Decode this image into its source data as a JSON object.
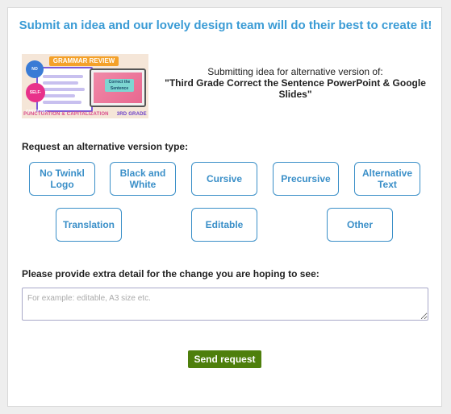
{
  "headline": "Submit an idea and our lovely design team will do their best to create it!",
  "thumbnail": {
    "banner": "GRAMMAR REVIEW",
    "badge_1": "NO PREP",
    "badge_2": "SELF-CHECKING",
    "slide_title": "Correct the Sentence",
    "footer_left": "PUNCTUATION & CAPITALIZATION",
    "footer_right": "3RD GRADE"
  },
  "submit_info": {
    "intro": "Submitting idea for alternative version of:",
    "resource_title": "\"Third Grade Correct the Sentence PowerPoint & Google Slides\""
  },
  "version_type": {
    "label": "Request an alternative version type:",
    "options": [
      "No Twinkl Logo",
      "Black and White",
      "Cursive",
      "Precursive",
      "Alternative Text",
      "Translation",
      "Editable",
      "Other"
    ]
  },
  "detail": {
    "label": "Please provide extra detail for the change you are hoping to see:",
    "placeholder": "For example: editable, A3 size etc.",
    "value": ""
  },
  "send_button": "Send request",
  "colors": {
    "headline": "#3a9bd5",
    "option_border": "#3a8fc8",
    "send_button": "#4e7f0c"
  }
}
